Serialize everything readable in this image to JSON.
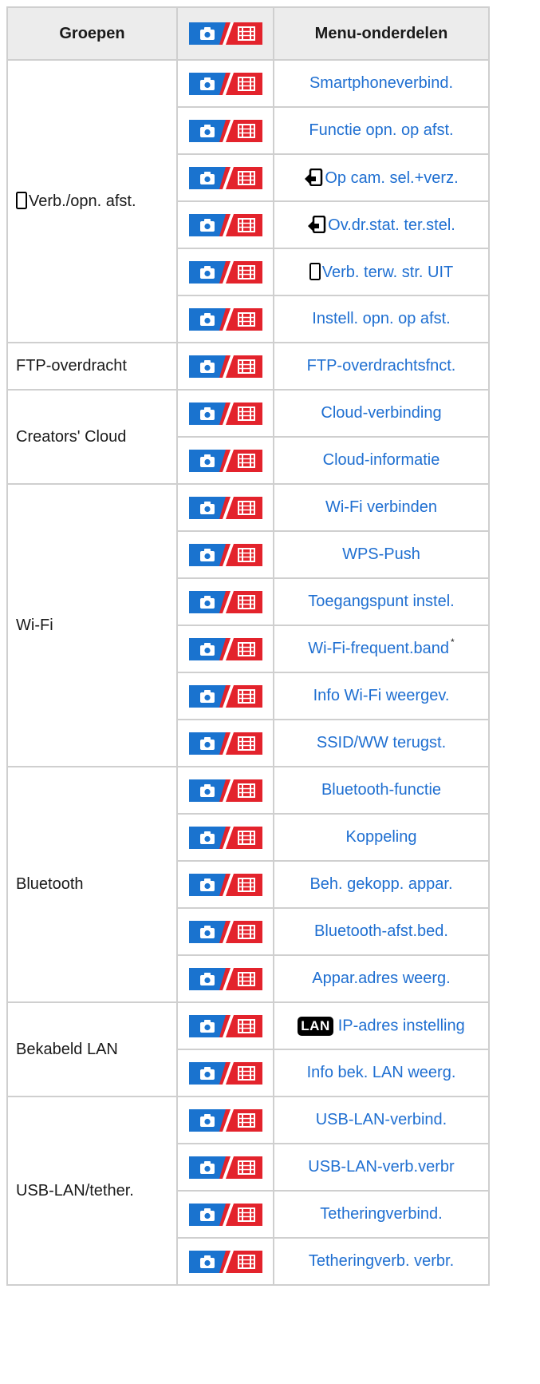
{
  "header": {
    "groups": "Groepen",
    "items": "Menu-onderdelen"
  },
  "colors": {
    "photo_blue": "#1a73cf",
    "movie_red": "#e3232c",
    "link": "#1f6fd1"
  },
  "icons": {
    "mode_badge": "photo-movie-badge",
    "phone": "smartphone-icon",
    "transfer": "transfer-icon",
    "lan": "lan-badge"
  },
  "groups": {
    "g1": "Verb./opn. afst.",
    "g2": "FTP-overdracht",
    "g3": "Creators' Cloud",
    "g4": "Wi-Fi",
    "g5": "Bluetooth",
    "g6": "Bekabeld LAN",
    "g7": "USB-LAN/tether."
  },
  "items": {
    "i1": "Smartphoneverbind.",
    "i2": "Functie opn. op afst.",
    "i3": "Op cam. sel.+verz.",
    "i4": "Ov.dr.stat. ter.stel.",
    "i5": "Verb. terw. str. UIT",
    "i6": "Instell. opn. op afst.",
    "i7": "FTP-overdrachtsfnct.",
    "i8": "Cloud-verbinding",
    "i9": "Cloud-informatie",
    "i10": "Wi-Fi verbinden",
    "i11": "WPS-Push",
    "i12": "Toegangspunt instel.",
    "i13": "Wi-Fi-frequent.band",
    "i13_note": "*",
    "i14": "Info Wi-Fi weergev.",
    "i15": "SSID/WW terugst.",
    "i16": "Bluetooth-functie",
    "i17": "Koppeling",
    "i18": "Beh. gekopp. appar.",
    "i19": "Bluetooth-afst.bed.",
    "i20": "Appar.adres weerg.",
    "lan_label": "LAN",
    "i21": "IP-adres instelling",
    "i22": "Info bek. LAN weerg.",
    "i23": "USB-LAN-verbind.",
    "i24": "USB-LAN-verb.verbr",
    "i25": "Tetheringverbind.",
    "i26": "Tetheringverb. verbr."
  }
}
